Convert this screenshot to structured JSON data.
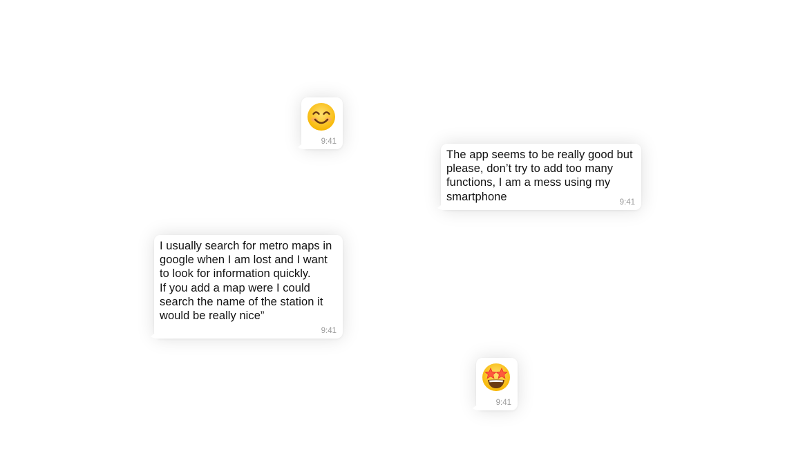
{
  "conversation": {
    "messages": [
      {
        "type": "emoji",
        "emoji": "smiling-face-with-smiling-eyes",
        "time": "9:41"
      },
      {
        "type": "text",
        "text": "The app seems to be really good but\nplease, don’t try to add too many\nfunctions, I am a mess using my\nsmartphone",
        "time": "9:41"
      },
      {
        "type": "text",
        "text": "I usually search for metro maps in\ngoogle when I am lost and I want\nto look for information quickly.\nIf you add a map were I could\nsearch the name of the station it\nwould be really nice”",
        "time": "9:41"
      },
      {
        "type": "emoji",
        "emoji": "star-struck-face",
        "time": "9:41"
      }
    ]
  },
  "colors": {
    "bubble": "#ffffff",
    "text": "#111111",
    "timestamp": "#9a9a9a",
    "emoji_face": "#fcc21b",
    "emoji_feature": "#6b3a12"
  }
}
